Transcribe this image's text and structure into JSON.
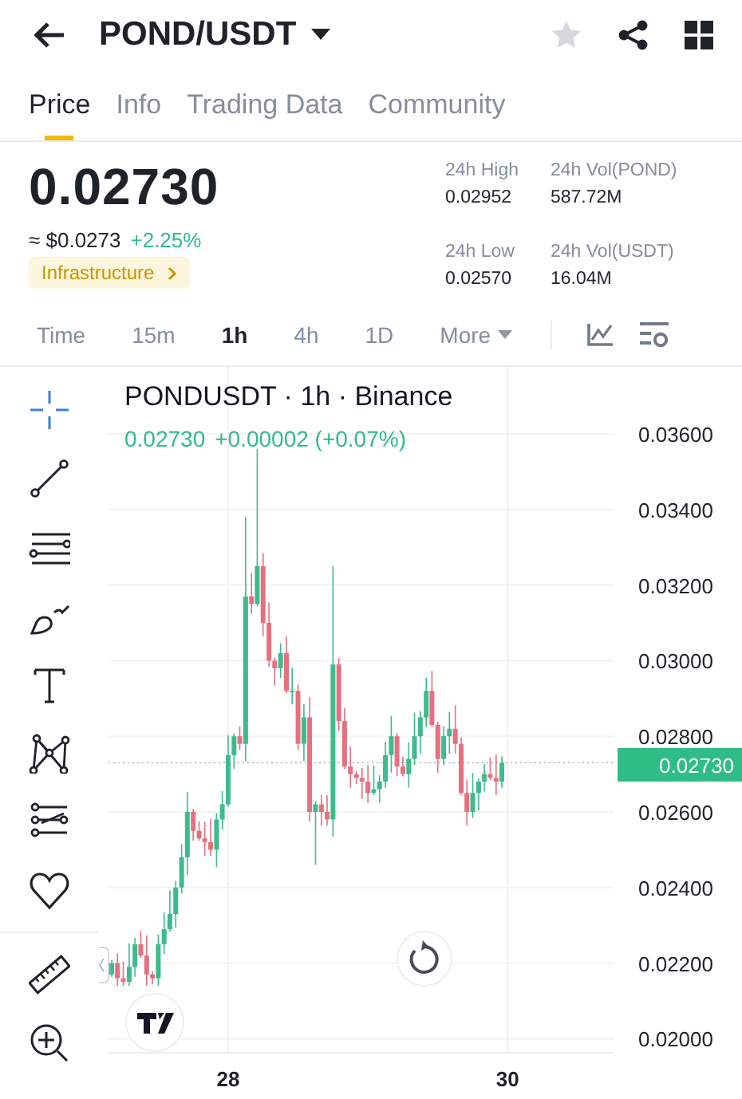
{
  "header": {
    "title": "POND/USDT",
    "favorite": false
  },
  "tabs": [
    {
      "label": "Price",
      "selected": true
    },
    {
      "label": "Info",
      "selected": false
    },
    {
      "label": "Trading Data",
      "selected": false
    },
    {
      "label": "Community",
      "selected": false
    }
  ],
  "summary": {
    "last_price": "0.02730",
    "usd_price": "≈ $0.0273",
    "change": "+2.25%",
    "tag": "Infrastructure"
  },
  "stats": [
    {
      "label": "24h High",
      "value": "0.02952"
    },
    {
      "label": "24h Vol(POND)",
      "value": "587.72M"
    },
    {
      "label": "24h Low",
      "value": "0.02570"
    },
    {
      "label": "24h Vol(USDT)",
      "value": "16.04M"
    }
  ],
  "intervals": [
    {
      "label": "Time",
      "selected": false,
      "kind": "plain"
    },
    {
      "label": "15m",
      "selected": false,
      "kind": "plain"
    },
    {
      "label": "1h",
      "selected": true,
      "kind": "plain"
    },
    {
      "label": "4h",
      "selected": false,
      "kind": "plain"
    },
    {
      "label": "1D",
      "selected": false,
      "kind": "plain"
    },
    {
      "label": "More",
      "selected": false,
      "kind": "dropdown"
    }
  ],
  "drawing_tools": [
    {
      "kind": "crosshair",
      "selected": true
    },
    {
      "kind": "trend-line",
      "selected": false
    },
    {
      "kind": "parallel-lines",
      "selected": false
    },
    {
      "kind": "brush",
      "selected": false
    },
    {
      "kind": "text",
      "selected": false
    },
    {
      "kind": "pattern",
      "selected": false
    },
    {
      "kind": "projection",
      "selected": false
    },
    {
      "kind": "heart",
      "selected": false
    },
    {
      "kind": "ruler",
      "selected": false
    },
    {
      "kind": "zoom",
      "selected": false
    }
  ],
  "chart": {
    "legend_title": "PONDUSDT · 1h · Binance",
    "legend_price": "0.02730",
    "legend_change": "+0.00002 (+0.07%)",
    "current_price": "0.02730",
    "chart_data": {
      "type": "candlestick",
      "x": [
        27.167,
        27.208,
        27.25,
        27.292,
        27.333,
        27.375,
        27.417,
        27.458,
        27.5,
        27.542,
        27.583,
        27.625,
        27.667,
        27.708,
        27.75,
        27.792,
        27.833,
        27.875,
        27.917,
        27.958,
        28,
        28.042,
        28.083,
        28.125,
        28.167,
        28.208,
        28.25,
        28.292,
        28.333,
        28.375,
        28.417,
        28.458,
        28.5,
        28.542,
        28.583,
        28.625,
        28.667,
        28.708,
        28.75,
        28.792,
        28.833,
        28.875,
        28.917,
        28.958,
        29,
        29.042,
        29.083,
        29.125,
        29.167,
        29.208,
        29.25,
        29.292,
        29.333,
        29.375,
        29.417,
        29.458,
        29.5,
        29.542,
        29.583,
        29.625,
        29.667,
        29.708,
        29.75,
        29.792,
        29.833,
        29.875,
        29.917,
        29.958
      ],
      "ohlc": [
        [
          0.0217,
          0.02208,
          0.02164,
          0.022
        ],
        [
          0.022,
          0.02226,
          0.0214,
          0.0216
        ],
        [
          0.0216,
          0.02204,
          0.0214,
          0.0215
        ],
        [
          0.0215,
          0.02252,
          0.0214,
          0.0219
        ],
        [
          0.0219,
          0.02267,
          0.02164,
          0.0225
        ],
        [
          0.0225,
          0.02285,
          0.02214,
          0.0222
        ],
        [
          0.0222,
          0.02273,
          0.0214,
          0.0217
        ],
        [
          0.0217,
          0.02178,
          0.02144,
          0.0216
        ],
        [
          0.0216,
          0.02276,
          0.0214,
          0.0225
        ],
        [
          0.0225,
          0.02334,
          0.02224,
          0.0229
        ],
        [
          0.0229,
          0.02392,
          0.02284,
          0.0233
        ],
        [
          0.0233,
          0.02417,
          0.02294,
          0.024
        ],
        [
          0.024,
          0.02515,
          0.02384,
          0.0248
        ],
        [
          0.0248,
          0.02653,
          0.02434,
          0.026
        ],
        [
          0.026,
          0.02608,
          0.02524,
          0.0255
        ],
        [
          0.0255,
          0.02576,
          0.02524,
          0.0253
        ],
        [
          0.0253,
          0.02574,
          0.02484,
          0.0252
        ],
        [
          0.0252,
          0.02582,
          0.02484,
          0.025
        ],
        [
          0.025,
          0.02597,
          0.02454,
          0.0258
        ],
        [
          0.0258,
          0.02655,
          0.02554,
          0.0262
        ],
        [
          0.0262,
          0.02803,
          0.02614,
          0.0275
        ],
        [
          0.0275,
          0.02808,
          0.02714,
          0.028
        ],
        [
          0.028,
          0.02826,
          0.02764,
          0.0278
        ],
        [
          0.0278,
          0.0338,
          0.02734,
          0.0317
        ],
        [
          0.0317,
          0.03232,
          0.03124,
          0.0315
        ],
        [
          0.0315,
          0.0356,
          0.03144,
          0.0325
        ],
        [
          0.0325,
          0.03285,
          0.03064,
          0.031
        ],
        [
          0.031,
          0.03153,
          0.02984,
          0.03
        ],
        [
          0.03,
          0.03008,
          0.02934,
          0.0298
        ],
        [
          0.0298,
          0.03046,
          0.02954,
          0.0302
        ],
        [
          0.0302,
          0.03064,
          0.02914,
          0.0292
        ],
        [
          0.0292,
          0.02982,
          0.02884,
          0.0292
        ],
        [
          0.0292,
          0.02937,
          0.02764,
          0.0278
        ],
        [
          0.0278,
          0.02885,
          0.02734,
          0.0285
        ],
        [
          0.0285,
          0.02903,
          0.02574,
          0.026
        ],
        [
          0.026,
          0.02628,
          0.0246,
          0.0262
        ],
        [
          0.0262,
          0.02646,
          0.02564,
          0.026
        ],
        [
          0.026,
          0.02644,
          0.02564,
          0.0258
        ],
        [
          0.0258,
          0.0325,
          0.02534,
          0.0299
        ],
        [
          0.0299,
          0.03007,
          0.02814,
          0.0284
        ],
        [
          0.0284,
          0.02875,
          0.02714,
          0.0272
        ],
        [
          0.0272,
          0.02773,
          0.02664,
          0.027
        ],
        [
          0.027,
          0.02708,
          0.02674,
          0.0269
        ],
        [
          0.0269,
          0.02716,
          0.02634,
          0.0268
        ],
        [
          0.0268,
          0.02724,
          0.02624,
          0.0265
        ],
        [
          0.0265,
          0.02722,
          0.02644,
          0.0266
        ],
        [
          0.0266,
          0.02697,
          0.02624,
          0.0268
        ],
        [
          0.0268,
          0.02785,
          0.02664,
          0.0275
        ],
        [
          0.0275,
          0.02853,
          0.02704,
          0.028
        ],
        [
          0.028,
          0.02808,
          0.02694,
          0.0272
        ],
        [
          0.0272,
          0.02746,
          0.02694,
          0.027
        ],
        [
          0.027,
          0.02784,
          0.02664,
          0.0274
        ],
        [
          0.0274,
          0.02862,
          0.02724,
          0.028
        ],
        [
          0.028,
          0.02867,
          0.02754,
          0.0285
        ],
        [
          0.0285,
          0.02955,
          0.02824,
          0.0292
        ],
        [
          0.0292,
          0.02973,
          0.02824,
          0.0283
        ],
        [
          0.0283,
          0.02838,
          0.02704,
          0.0274
        ],
        [
          0.0274,
          0.02826,
          0.02724,
          0.028
        ],
        [
          0.028,
          0.02864,
          0.02754,
          0.0282
        ],
        [
          0.0282,
          0.02882,
          0.02754,
          0.0278
        ],
        [
          0.0278,
          0.02797,
          0.02644,
          0.0265
        ],
        [
          0.0265,
          0.02685,
          0.02564,
          0.026
        ],
        [
          0.026,
          0.02703,
          0.02584,
          0.0265
        ],
        [
          0.0265,
          0.02688,
          0.02604,
          0.0268
        ],
        [
          0.0268,
          0.02726,
          0.02654,
          0.027
        ],
        [
          0.027,
          0.02744,
          0.02684,
          0.0269
        ],
        [
          0.0269,
          0.02752,
          0.02644,
          0.0268
        ],
        [
          0.0268,
          0.02747,
          0.02664,
          0.0273
        ]
      ],
      "xlim": [
        27.144,
        30.763
      ],
      "ylim": [
        0.01963,
        0.03777
      ],
      "grid": true,
      "ref_lines": [
        {
          "axis": "y",
          "value": 0.0273
        }
      ],
      "xticks": [
        {
          "value": 28,
          "label": "28"
        },
        {
          "value": 30,
          "label": "30"
        }
      ],
      "yticks": [
        {
          "value": 0.036,
          "label": "0.03600"
        },
        {
          "value": 0.034,
          "label": "0.03400"
        },
        {
          "value": 0.032,
          "label": "0.03200"
        },
        {
          "value": 0.03,
          "label": "0.03000"
        },
        {
          "value": 0.028,
          "label": "0.02800"
        },
        {
          "value": 0.026,
          "label": "0.02600"
        },
        {
          "value": 0.024,
          "label": "0.02400"
        },
        {
          "value": 0.022,
          "label": "0.02200"
        },
        {
          "value": 0.02,
          "label": "0.02000"
        }
      ]
    }
  }
}
